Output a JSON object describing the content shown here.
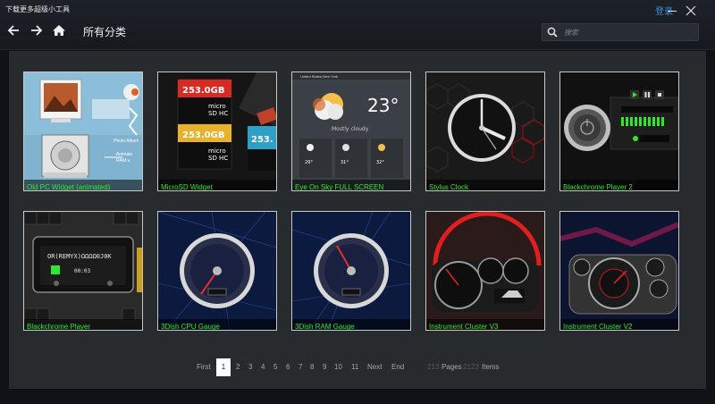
{
  "window": {
    "title": "下载更多超级小工具",
    "login_label": "登录"
  },
  "nav": {
    "heading": "所有分类"
  },
  "search": {
    "placeholder": "搜索"
  },
  "cards": [
    {
      "caption": "Old PC Widget (animated)",
      "texts": {
        "a": "Photo Album",
        "b": "Animate",
        "c": "RAM u"
      }
    },
    {
      "caption": "MicroSD Widget",
      "texts": {
        "a": "253.0GB",
        "b": "253.0GB",
        "c": "253."
      }
    },
    {
      "caption": "Eye On Sky FULL SCREEN",
      "texts": {
        "a": "United States,New York",
        "b": "23°",
        "c": "Mostly cloudy",
        "d": "29°",
        "e": "31°",
        "f": "32°"
      }
    },
    {
      "caption": "Stylus Clock"
    },
    {
      "caption": "Blackchrome Player 2"
    },
    {
      "caption": "Blackchrome Player"
    },
    {
      "caption": "3Dish CPU Gauge"
    },
    {
      "caption": "3Dish RAM Gauge"
    },
    {
      "caption": "Instrument Cluster V3"
    },
    {
      "caption": "Instrument Cluster V2"
    }
  ],
  "pager": {
    "first": "First",
    "pages": [
      "1",
      "2",
      "3",
      "4",
      "5",
      "6",
      "7",
      "8",
      "9",
      "10",
      "11"
    ],
    "current": "1",
    "next": "Next",
    "end": "End",
    "page_count": "213",
    "pages_label": "Pages",
    "item_count": "2123",
    "items_label": "Items"
  }
}
